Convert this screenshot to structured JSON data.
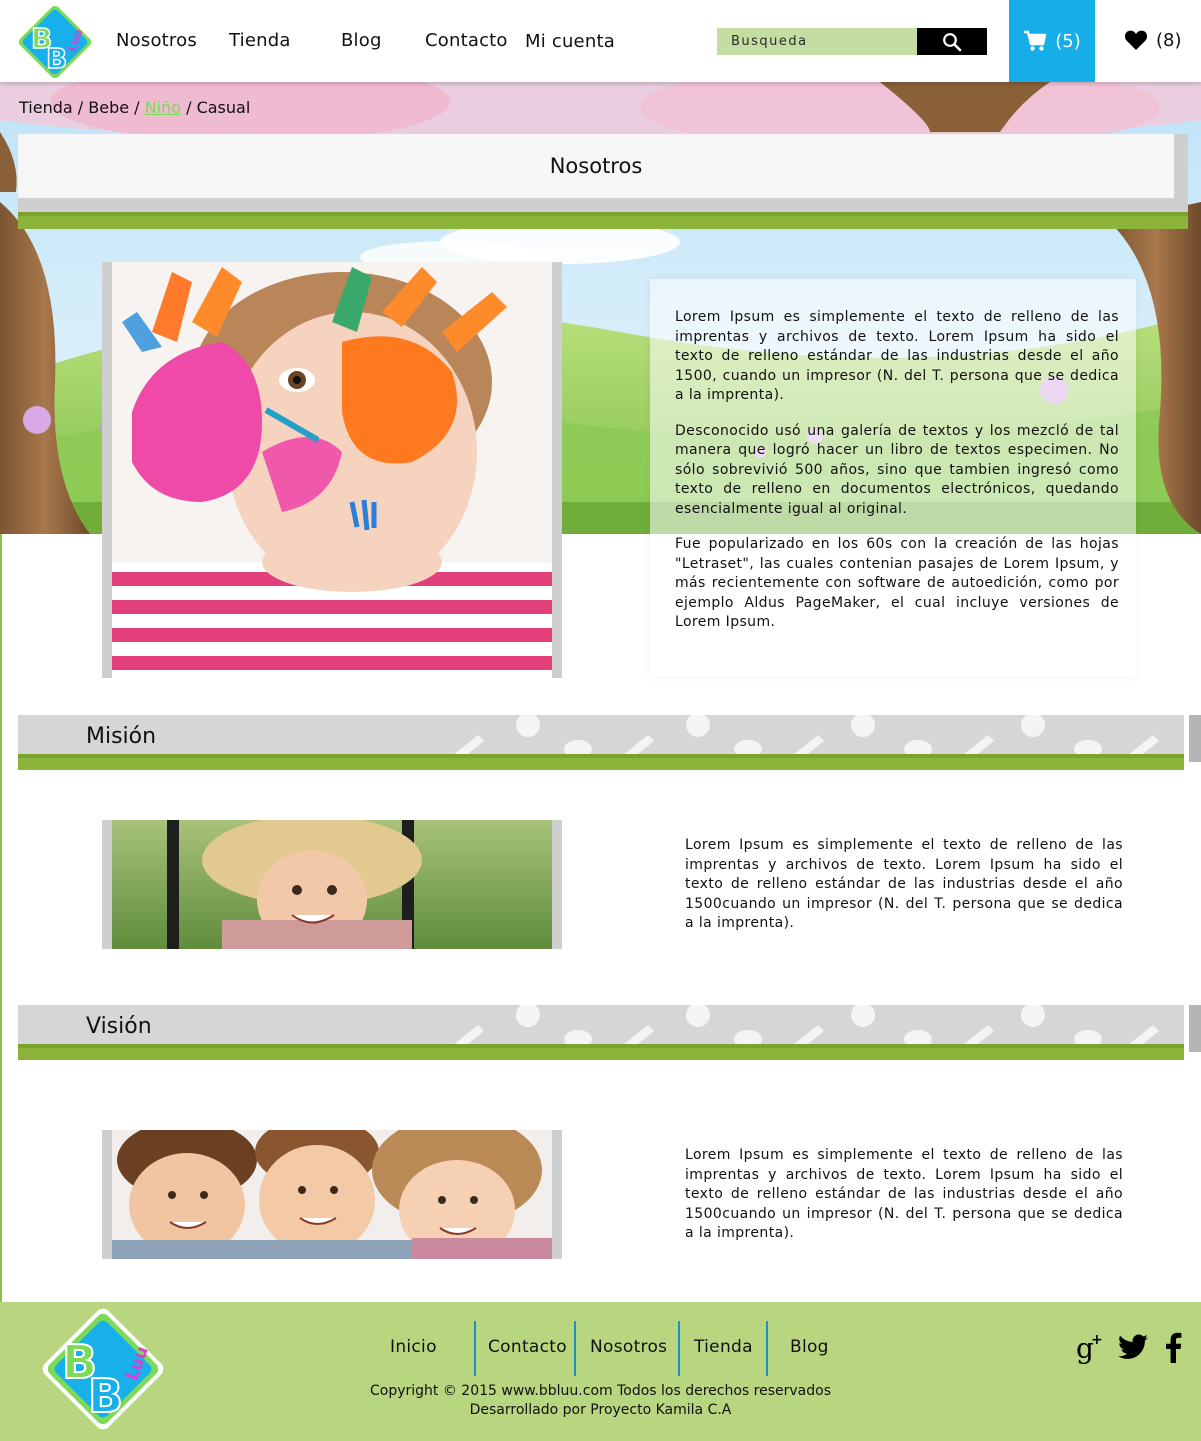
{
  "header": {
    "logo_alt": "BBLuu",
    "nav": [
      {
        "label": "Nosotros"
      },
      {
        "label": "Tienda"
      },
      {
        "label": "Blog"
      },
      {
        "label": "Contacto"
      },
      {
        "label": "Mi cuenta"
      }
    ],
    "search_placeholder": "Busqueda",
    "cart_count": "(5)",
    "favorites_count": "(8)"
  },
  "breadcrumb": {
    "items": [
      "Tienda",
      "Bebe",
      "Niño",
      "Casual"
    ],
    "separator": "/"
  },
  "page_title": "Nosotros",
  "about": {
    "paragraphs": [
      "Lorem Ipsum es simplemente el texto de relleno de las imprentas y archivos de texto. Lorem Ipsum ha sido el texto de relleno estándar de las industrias desde el año 1500, cuando un impresor (N. del T. persona que se dedica a la imprenta).",
      "Desconocido usó una galería de textos y los mezcló de tal manera que logró hacer un libro de textos especimen. No sólo sobrevivió 500 años, sino que tambien ingresó como texto de relleno en documentos electrónicos, quedando esencialmente igual al original.",
      "Fue popularizado en los 60s con la creación de las hojas \"Letraset\", las cuales contenian pasajes de Lorem Ipsum, y más recientemente con software de autoedición, como por ejemplo Aldus PageMaker, el cual incluye versiones de Lorem Ipsum."
    ]
  },
  "mision": {
    "title": "Misión",
    "text": "Lorem Ipsum es simplemente el texto de relleno de las imprentas y archivos de texto. Lorem Ipsum ha sido el texto de relleno estándar de las industrias desde el año 1500cuando un impresor (N. del T. persona que se dedica a la imprenta)."
  },
  "vision": {
    "title": "Visión",
    "text": "Lorem Ipsum es simplemente el texto de relleno de las imprentas y archivos de texto. Lorem Ipsum ha sido el texto de relleno estándar de las industrias desde el año 1500cuando un impresor (N. del T. persona que se dedica a la imprenta)."
  },
  "footer": {
    "links": [
      {
        "label": "Inicio"
      },
      {
        "label": "Contacto"
      },
      {
        "label": "Nosotros"
      },
      {
        "label": "Tienda"
      },
      {
        "label": "Blog"
      }
    ],
    "copyright": "Copyright © 2015 www.bbluu.com Todos los derechos reservados",
    "developer": "Desarrollado por Proyecto Kamila C.A",
    "social": [
      "google-plus-icon",
      "twitter-icon",
      "facebook-icon"
    ]
  },
  "colors": {
    "cart_blue": "#16aee8",
    "search_green": "#c3dda3",
    "accent_green": "#8cb43a",
    "footer_green": "#b7d67f",
    "breadcrumb_active": "#7ed957"
  }
}
